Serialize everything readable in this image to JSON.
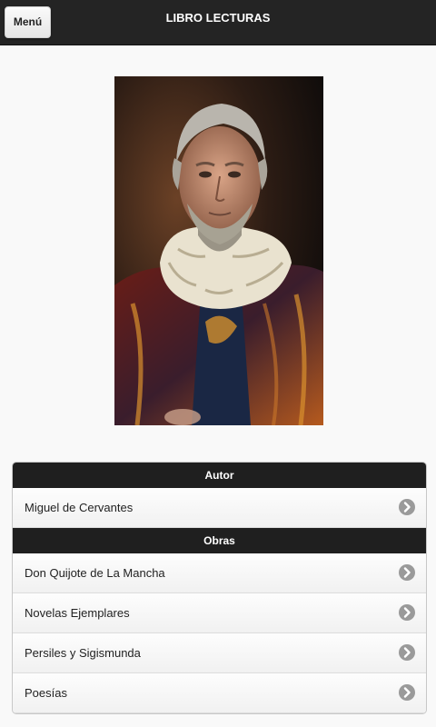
{
  "header": {
    "menu_label": "Menú",
    "title": "LIBRO LECTURAS"
  },
  "portrait": {
    "alt": "Retrato de Miguel de Cervantes"
  },
  "sections": [
    {
      "title": "Autor",
      "items": [
        "Miguel de Cervantes"
      ]
    },
    {
      "title": "Obras",
      "items": [
        "Don Quijote de La Mancha",
        "Novelas Ejemplares",
        "Persiles y Sigismunda",
        "Poesías"
      ]
    }
  ],
  "icons": {
    "chevron": "chevron-right-icon"
  }
}
